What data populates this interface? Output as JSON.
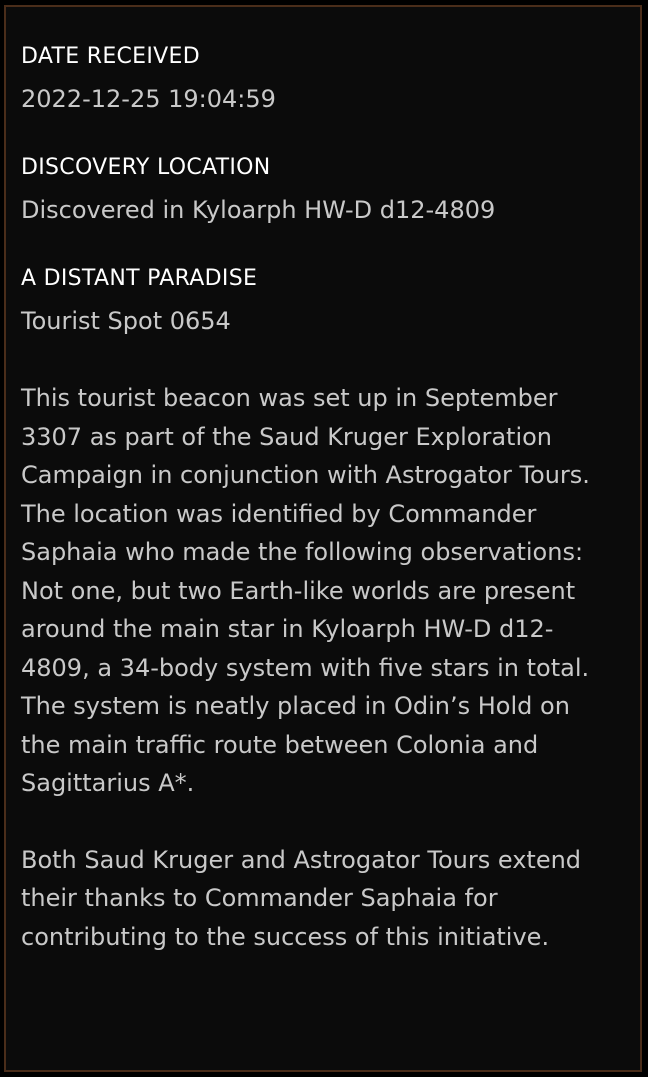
{
  "date_received": {
    "heading": "DATE RECEIVED",
    "value": "2022-12-25 19:04:59"
  },
  "discovery_location": {
    "heading": "DISCOVERY LOCATION",
    "value": "Discovered in Kyloarph HW-D d12-4809"
  },
  "entry": {
    "heading": "A DISTANT PARADISE",
    "subtitle": "Tourist Spot 0654",
    "paragraphs": [
      "This tourist beacon was set up in September\n3307 as part of the Saud Kruger Exploration\nCampaign in conjunction with Astrogator Tours.\nThe location was identified by Commander\nSaphaia who made the following observations:\nNot one, but two Earth-like worlds are present\naround the main star in Kyloarph HW-D d12-\n4809, a 34-body system with five stars in total.\nThe system is neatly placed in Odin’s Hold on\nthe main traffic route between Colonia and\nSagittarius A*.",
      "Both Saud Kruger and Astrogator Tours extend\ntheir thanks to Commander Saphaia for\ncontributing to the success of this initiative."
    ]
  }
}
